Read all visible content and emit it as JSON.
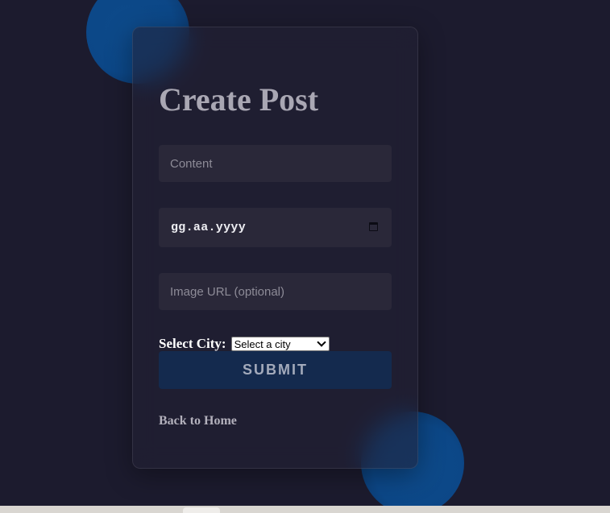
{
  "form": {
    "title": "Create Post",
    "content_placeholder": "Content",
    "date_placeholder": "gg.aa.yyyy",
    "image_placeholder": "Image URL (optional)",
    "city_label": "Select City:",
    "city_selected": "Select a city",
    "submit_label": "SUBMIT",
    "back_link": "Back to Home"
  },
  "icons": {
    "calendar": "calendar-icon",
    "dropdown": "chevron-down-icon"
  },
  "colors": {
    "background": "#1c1b2e",
    "card": "#222134",
    "input": "#2a2839",
    "submit": "#142a4e",
    "accent_blob": "#0c4787"
  }
}
